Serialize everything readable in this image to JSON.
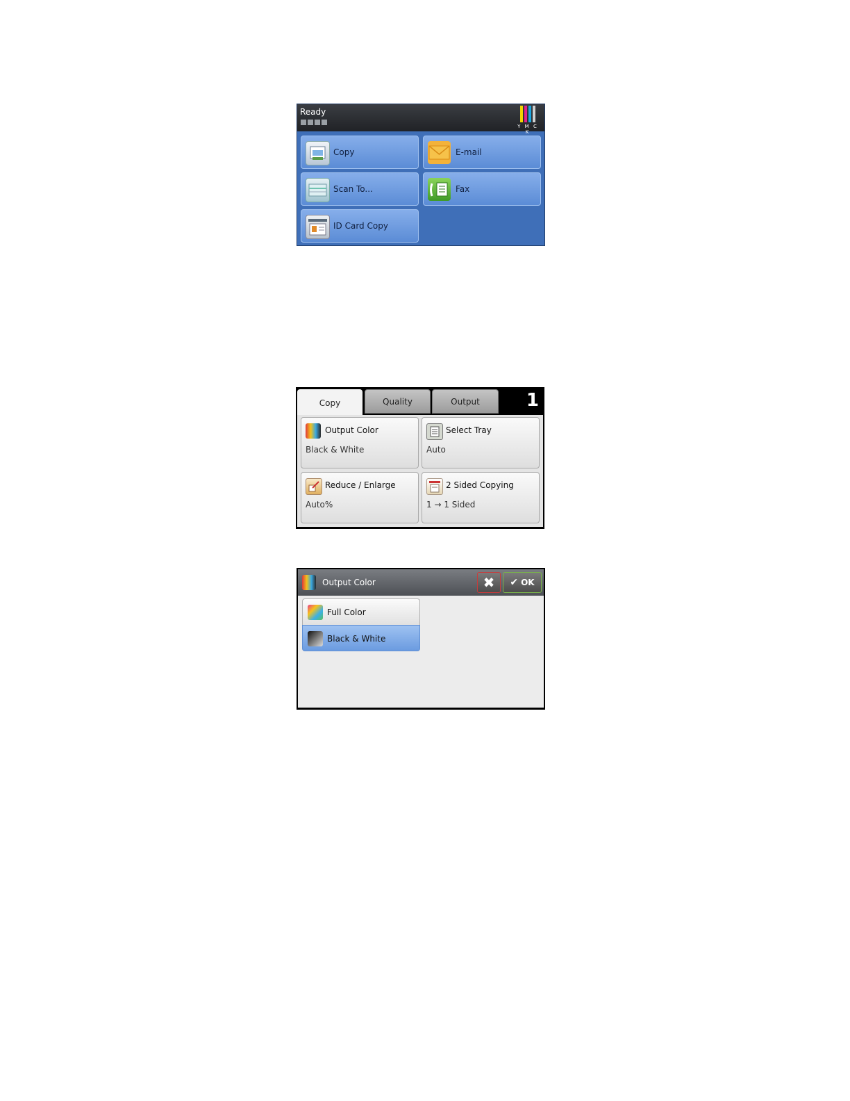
{
  "home": {
    "status": "Ready",
    "toner_label": "Y M C K",
    "toner_colors": [
      "#f2d500",
      "#e0218a",
      "#1aa6e0",
      "#222222"
    ],
    "tiles": [
      {
        "label": "Copy",
        "icon": "copy-icon"
      },
      {
        "label": "E-mail",
        "icon": "envelope-icon"
      },
      {
        "label": "Scan To...",
        "icon": "scanner-icon"
      },
      {
        "label": "Fax",
        "icon": "fax-icon"
      },
      {
        "label": "ID Card Copy",
        "icon": "id-card-icon"
      }
    ]
  },
  "copy": {
    "tabs": [
      "Copy",
      "Quality",
      "Output"
    ],
    "active_tab": "Copy",
    "quantity": "1",
    "features": [
      {
        "title": "Output Color",
        "value": "Black & White",
        "icon": "color-icon"
      },
      {
        "title": "Select Tray",
        "value": "Auto",
        "icon": "tray-icon"
      },
      {
        "title": "Reduce / Enlarge",
        "value": "Auto%",
        "icon": "resize-icon"
      },
      {
        "title": "2 Sided Copying",
        "value": "1 → 1 Sided",
        "icon": "duplex-icon"
      }
    ]
  },
  "dialog": {
    "title": "Output Color",
    "cancel": "✖",
    "ok": "OK",
    "options": [
      {
        "label": "Full Color",
        "selected": false,
        "icon": "full-color-icon"
      },
      {
        "label": "Black & White",
        "selected": true,
        "icon": "black-white-icon"
      }
    ]
  }
}
